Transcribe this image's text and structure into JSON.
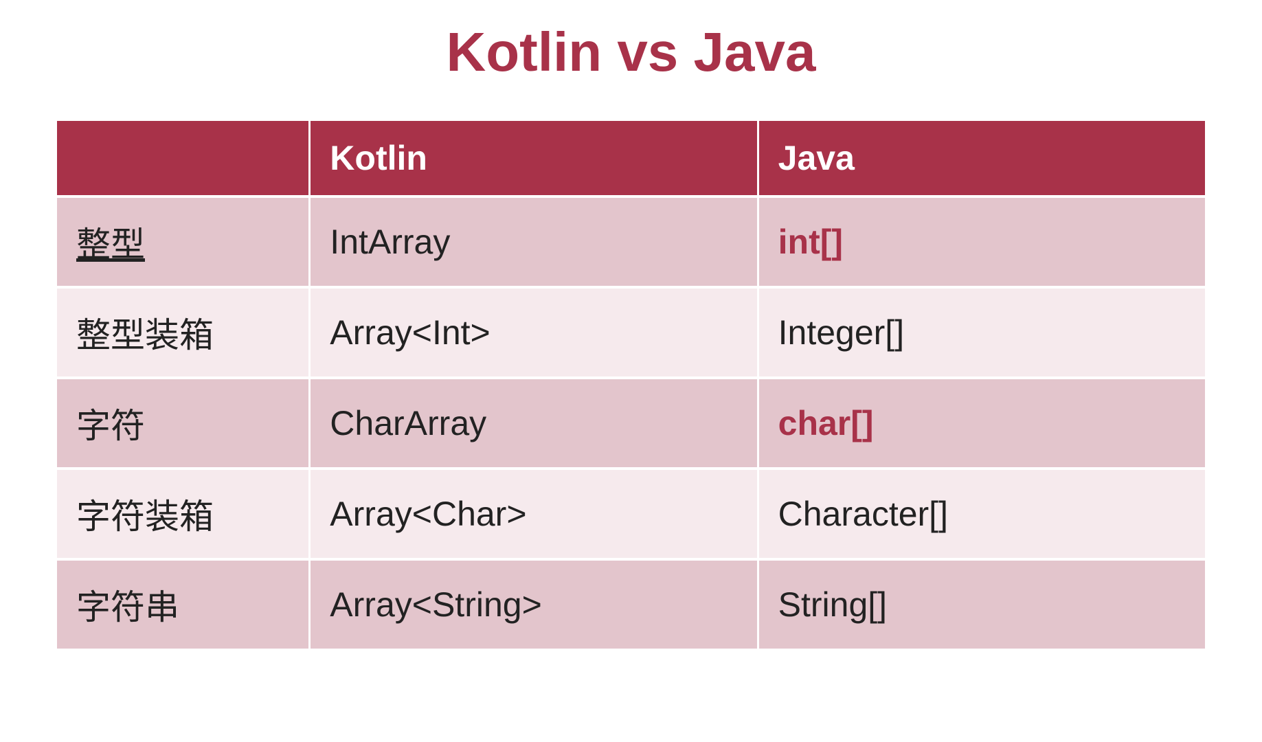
{
  "title": "Kotlin vs Java",
  "headers": {
    "c1": "",
    "c2": "Kotlin",
    "c3": "Java"
  },
  "rows": [
    {
      "label": "整型",
      "kotlin": "IntArray",
      "java": "int[]",
      "labelUnderline": true,
      "javaEmph": true
    },
    {
      "label": "整型装箱",
      "kotlin": "Array<Int>",
      "java": "Integer[]",
      "labelUnderline": false,
      "javaEmph": false
    },
    {
      "label": "字符",
      "kotlin": "CharArray",
      "java": "char[]",
      "labelUnderline": false,
      "javaEmph": true
    },
    {
      "label": "字符装箱",
      "kotlin": "Array<Char>",
      "java": "Character[]",
      "labelUnderline": false,
      "javaEmph": false
    },
    {
      "label": "字符串",
      "kotlin": "Array<String>",
      "java": "String[]",
      "labelUnderline": false,
      "javaEmph": false
    }
  ]
}
